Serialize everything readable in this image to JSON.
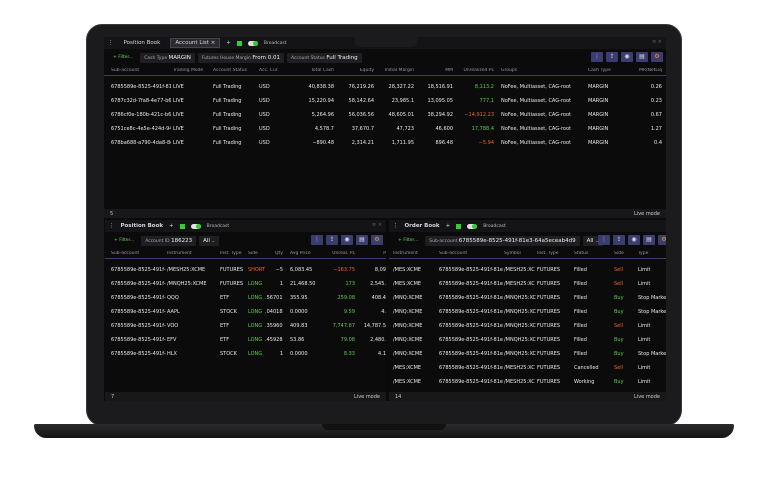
{
  "account_list": {
    "tabs": [
      "Position Book",
      "Account List"
    ],
    "broadcast": "Broadcast",
    "filter": "+ Filter...",
    "chips": [
      {
        "label": "Cash Type",
        "value": "MARGIN"
      },
      {
        "label": "Futures House Margin",
        "value": "From 0.01"
      },
      {
        "label": "Account Status",
        "value": "Full Trading"
      }
    ],
    "columns": [
      "Sub-account",
      "Trading Mode",
      "Account Status",
      "Acc. Cur.",
      "Total Cash",
      "Equity",
      "Initial Margin",
      "MM",
      "Unrealized PL",
      "Groups",
      "Cash Type",
      "MR/NetLiq"
    ],
    "rows": [
      [
        "6785589e-8525-491f-81e3",
        "LIVE",
        "Full Trading",
        "USD",
        "40,838.38",
        "76,219.26",
        "28,327.22",
        "18,516.91",
        "8,113.2",
        "NoFee, Multiasset, CAG-root",
        "MARGIN",
        "0.26"
      ],
      [
        "6787c32d-7fa8-4e77-b6c",
        "LIVE",
        "Full Trading",
        "USD",
        "15,220.94",
        "58,142.64",
        "23,985.1",
        "13,095.05",
        "777.1",
        "NoFee, Multiasset, CAG-root",
        "MARGIN",
        "0.23"
      ],
      [
        "6786cf0e-180b-421c-b61",
        "LIVE",
        "Full Trading",
        "USD",
        "5,264.96",
        "56,036.56",
        "48,605.01",
        "38,294.92",
        "−14,912.23",
        "NoFee, Multiasset, CAG-root",
        "MARGIN",
        "0.67"
      ],
      [
        "6751ce8c-4e5e-424d-943",
        "LIVE",
        "Full Trading",
        "USD",
        "4,578.7",
        "37,670.7",
        "47,723",
        "46,600",
        "17,788.4",
        "NoFee, Multiasset, CAG-root",
        "MARGIN",
        "1.27"
      ],
      [
        "678ba688-a790-4da8-8c1",
        "LIVE",
        "Full Trading",
        "USD",
        "−890.48",
        "2,314.21",
        "1,711.95",
        "896.48",
        "−5.94",
        "NoFee, Multiasset, CAG-root",
        "MARGIN",
        "0.4"
      ]
    ],
    "count": "5",
    "mode": "Live mode"
  },
  "position_book": {
    "title": "Position Book",
    "broadcast": "Broadcast",
    "filter": "+ Filter...",
    "account_label": "Account ID",
    "account_value": "186223",
    "select": "All",
    "columns": [
      "Sub-account",
      "Instrument",
      "Inst. Type",
      "Side",
      "Qty",
      "Avg Price",
      "Unreal. PL",
      "P"
    ],
    "rows": [
      [
        "6785589e-8525-491f-81e3",
        "/MESH25:XCME",
        "FUTURES",
        "SHORT",
        "−5",
        "6,083.45",
        "−163.75",
        "8,09"
      ],
      [
        "6785589e-8525-491f-81e3",
        "/MNQH25:XCME",
        "FUTURES",
        "LONG",
        "1",
        "21,468.50",
        "173",
        "2,545."
      ],
      [
        "6785589e-8525-491f-81e3",
        "QQQ",
        "ETF",
        "LONG",
        ".567017",
        "355.95",
        "259.08",
        "408.4"
      ],
      [
        "6785589e-8525-491f-81e3",
        "AAPL",
        "STOCK",
        "LONG",
        ".040182",
        "0.0000",
        "9.59",
        "4."
      ],
      [
        "6785589e-8525-491f-81e3",
        "VOO",
        "ETF",
        "LONG",
        ".359601",
        "409.83",
        "7,747.87",
        "14,787.5"
      ],
      [
        "6785589e-8525-491f-81e3",
        "EFV",
        "ETF",
        "LONG",
        ".459283",
        "53.86",
        "79.08",
        "2,480."
      ],
      [
        "6785589e-8525-491f-81e3",
        "HLX",
        "STOCK",
        "LONG",
        "1",
        "0.0000",
        "8.33",
        "4.1"
      ]
    ],
    "count": "7",
    "mode": "Live mode"
  },
  "order_book": {
    "title": "Order Book",
    "broadcast": "Broadcast",
    "filter": "+ Filter...",
    "sub_label": "Sub-account",
    "sub_value": "6785589e-8525-491f-81e3-64a5eceab4d9",
    "select": "All",
    "columns": [
      "Instrument",
      "Sub-account",
      "Symbol",
      "Inst. Type",
      "Status",
      "Side",
      "Type"
    ],
    "rows": [
      [
        "/MES:XCME",
        "6785589e-8525-491f-81e3-",
        "/MESH25:XC",
        "FUTURES",
        "Filled",
        "Sell",
        "Limit"
      ],
      [
        "/MES:XCME",
        "6785589e-8525-491f-81e3-",
        "/MESH25:XC",
        "FUTURES",
        "Filled",
        "Sell",
        "Limit"
      ],
      [
        "/MNQ:XCME",
        "6785589e-8525-491f-81e3-",
        "/MNQH25:XC",
        "FUTURES",
        "Filled",
        "Buy",
        "Stop Market"
      ],
      [
        "/MNQ:XCME",
        "6785589e-8525-491f-81e3-",
        "/MNQH25:XC",
        "FUTURES",
        "Filled",
        "Buy",
        "Stop Market"
      ],
      [
        "/MNQ:XCME",
        "6785589e-8525-491f-81e3-",
        "/MNQH25:XC",
        "FUTURES",
        "Filled",
        "Sell",
        "Limit"
      ],
      [
        "/MNQ:XCME",
        "6785589e-8525-491f-81e3-",
        "/MNQH25:XC",
        "FUTURES",
        "Filled",
        "Buy",
        "Limit"
      ],
      [
        "/MNQ:XCME",
        "6785589e-8525-491f-81e3-",
        "/MNQH25:XC",
        "FUTURES",
        "Filled",
        "Buy",
        "Stop Market"
      ],
      [
        "/MES:XCME",
        "6785589e-8525-491f-81e3-",
        "/MESH25:XC",
        "FUTURES",
        "Cancelled",
        "Sell",
        "Limit"
      ],
      [
        "/MES:XCME",
        "6785589e-8525-491f-81e3-",
        "/MESH25:XC",
        "FUTURES",
        "Working",
        "Buy",
        "Limit"
      ]
    ],
    "count": "14",
    "mode": "Live mode"
  },
  "toolbar_icons": [
    "more-vertical-icon",
    "export-icon",
    "eye-icon",
    "calculator-icon",
    "settings-icon"
  ],
  "colors": {
    "positive": "#5fcf4a",
    "negative": "#f0642a",
    "accent": "#3b3d70"
  }
}
